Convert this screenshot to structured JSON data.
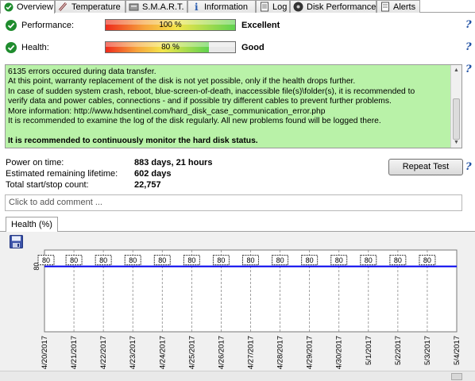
{
  "tabs": [
    {
      "label": "Overview",
      "icon": "overview-icon",
      "active": true
    },
    {
      "label": "Temperature",
      "icon": "thermometer-icon",
      "active": false
    },
    {
      "label": "S.M.A.R.T.",
      "icon": "smart-icon",
      "active": false
    },
    {
      "label": "Information",
      "icon": "info-icon",
      "active": false
    },
    {
      "label": "Log",
      "icon": "log-icon",
      "active": false
    },
    {
      "label": "Disk Performance",
      "icon": "disk-performance-icon",
      "active": false
    },
    {
      "label": "Alerts",
      "icon": "alerts-icon",
      "active": false
    }
  ],
  "performance": {
    "label": "Performance:",
    "value_text": "100 %",
    "value": 100,
    "rating": "Excellent"
  },
  "health": {
    "label": "Health:",
    "value_text": "80 %",
    "value": 80,
    "rating": "Good"
  },
  "message": {
    "lines": [
      "6135 errors occured during data transfer.",
      "At this point, warranty replacement of the disk is not yet possible, only if the health drops further.",
      "In case of sudden system crash, reboot, blue-screen-of-death, inaccessible file(s)\\folder(s), it is recommended to",
      "verify data and power cables, connections - and if possible try different cables to prevent further problems.",
      "More information: http://www.hdsentinel.com/hard_disk_case_communication_error.php",
      "It is recommended to examine the log of the disk regularly. All new problems found will be logged there."
    ],
    "bold_line": "It is recommended to continuously monitor the hard disk status.",
    "background": "#b9f2a8"
  },
  "stats": {
    "power_on_label": "Power on time:",
    "power_on_value": "883 days, 21 hours",
    "lifetime_label": "Estimated remaining lifetime:",
    "lifetime_value": "602 days",
    "startstop_label": "Total start/stop count:",
    "startstop_value": "22,757"
  },
  "repeat_test_label": "Repeat Test",
  "comment_placeholder": "Click to add comment ...",
  "help_glyph": "?",
  "chart_tab_label": "Health (%)",
  "chart_data": {
    "type": "line",
    "x": [
      "4/20/2017",
      "4/21/2017",
      "4/22/2017",
      "4/23/2017",
      "4/24/2017",
      "4/25/2017",
      "4/26/2017",
      "4/27/2017",
      "4/28/2017",
      "4/29/2017",
      "4/30/2017",
      "5/1/2017",
      "5/2/2017",
      "5/3/2017",
      "5/4/2017"
    ],
    "series": [
      {
        "values": [
          80,
          80,
          80,
          80,
          80,
          80,
          80,
          80,
          80,
          80,
          80,
          80,
          80,
          80,
          80
        ]
      }
    ],
    "data_labels": [
      "80",
      "80",
      "80",
      "80",
      "80",
      "80",
      "80",
      "80",
      "80",
      "80",
      "80",
      "80",
      "80",
      "80"
    ],
    "ytick": "80",
    "ylim": [
      0,
      100
    ],
    "line_color": "#0000ee",
    "grid": true
  }
}
